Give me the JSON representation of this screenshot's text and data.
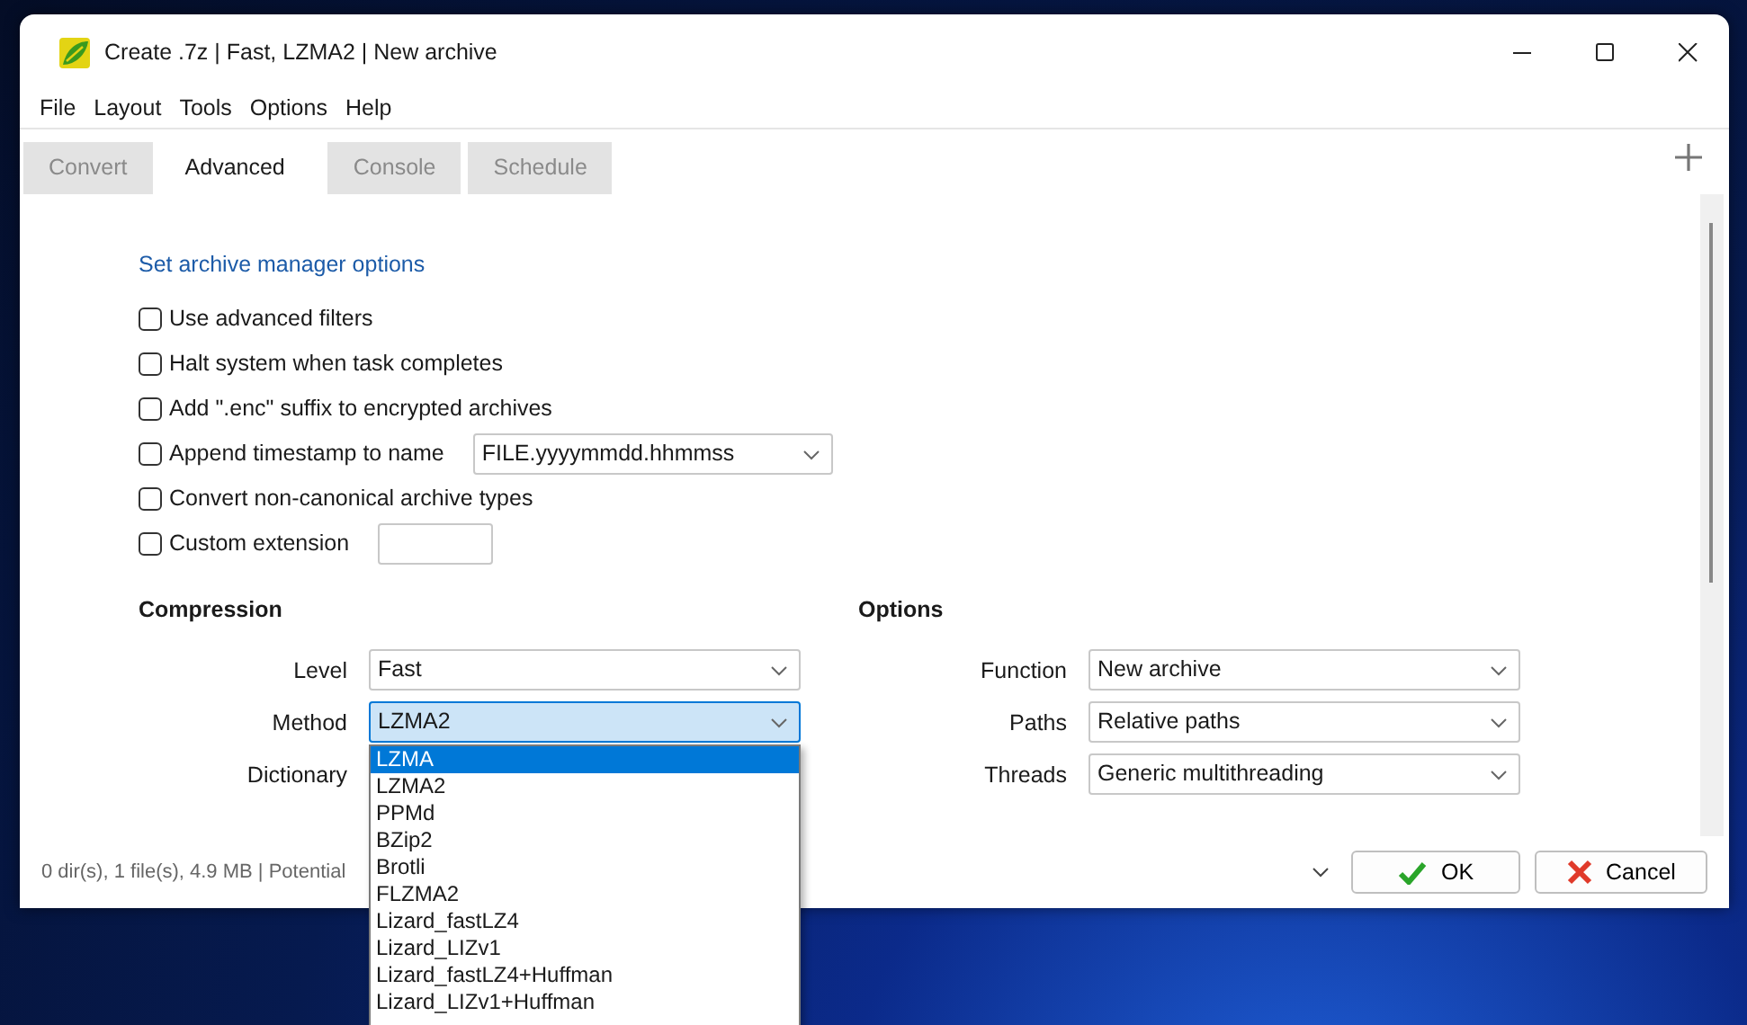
{
  "window": {
    "title": "Create .7z | Fast, LZMA2 | New archive"
  },
  "menu": [
    "File",
    "Layout",
    "Tools",
    "Options",
    "Help"
  ],
  "tabs": [
    {
      "label": "Convert",
      "selected": false
    },
    {
      "label": "Advanced",
      "selected": true
    },
    {
      "label": "Console",
      "selected": false
    },
    {
      "label": "Schedule",
      "selected": false
    }
  ],
  "advanced": {
    "link": "Set archive manager options",
    "checkboxes": [
      {
        "kind": "plain",
        "label": "Use advanced filters",
        "checked": false
      },
      {
        "kind": "plain",
        "label": "Halt system when task completes",
        "checked": false
      },
      {
        "kind": "plain",
        "label": "Add \".enc\" suffix to encrypted archives",
        "checked": false
      },
      {
        "kind": "select",
        "label": "Append timestamp to name",
        "checked": false,
        "value": "FILE.yyyymmdd.hhmmss"
      },
      {
        "kind": "plain",
        "label": "Convert non-canonical archive types",
        "checked": false
      },
      {
        "kind": "input",
        "label": "Custom extension",
        "checked": false
      }
    ]
  },
  "compression": {
    "title": "Compression",
    "fields": [
      {
        "label": "Level",
        "value": "Fast",
        "focused": false
      },
      {
        "label": "Method",
        "value": "LZMA2",
        "focused": true
      },
      {
        "label": "Dictionary"
      }
    ]
  },
  "options": {
    "title": "Options",
    "fields": [
      {
        "label": "Function",
        "value": "New archive",
        "focused": false
      },
      {
        "label": "Paths",
        "value": "Relative paths",
        "focused": false
      },
      {
        "label": "Threads",
        "value": "Generic multithreading",
        "focused": false
      }
    ]
  },
  "method_dropdown": {
    "items": [
      {
        "label": "LZMA",
        "selected": true
      },
      {
        "label": "LZMA2",
        "selected": false
      },
      {
        "label": "PPMd",
        "selected": false
      },
      {
        "label": "BZip2",
        "selected": false
      },
      {
        "label": "Brotli",
        "selected": false
      },
      {
        "label": "FLZMA2",
        "selected": false
      },
      {
        "label": "Lizard_fastLZ4",
        "selected": false
      },
      {
        "label": "Lizard_LIZv1",
        "selected": false
      },
      {
        "label": "Lizard_fastLZ4+Huffman",
        "selected": false
      },
      {
        "label": "Lizard_LIZv1+Huffman",
        "selected": false
      }
    ]
  },
  "status_bar": {
    "text": "0 dir(s), 1 file(s), 4.9 MB | Potential"
  },
  "buttons": [
    {
      "kind": "ok",
      "label": "OK"
    },
    {
      "kind": "cancel",
      "label": "Cancel"
    }
  ]
}
